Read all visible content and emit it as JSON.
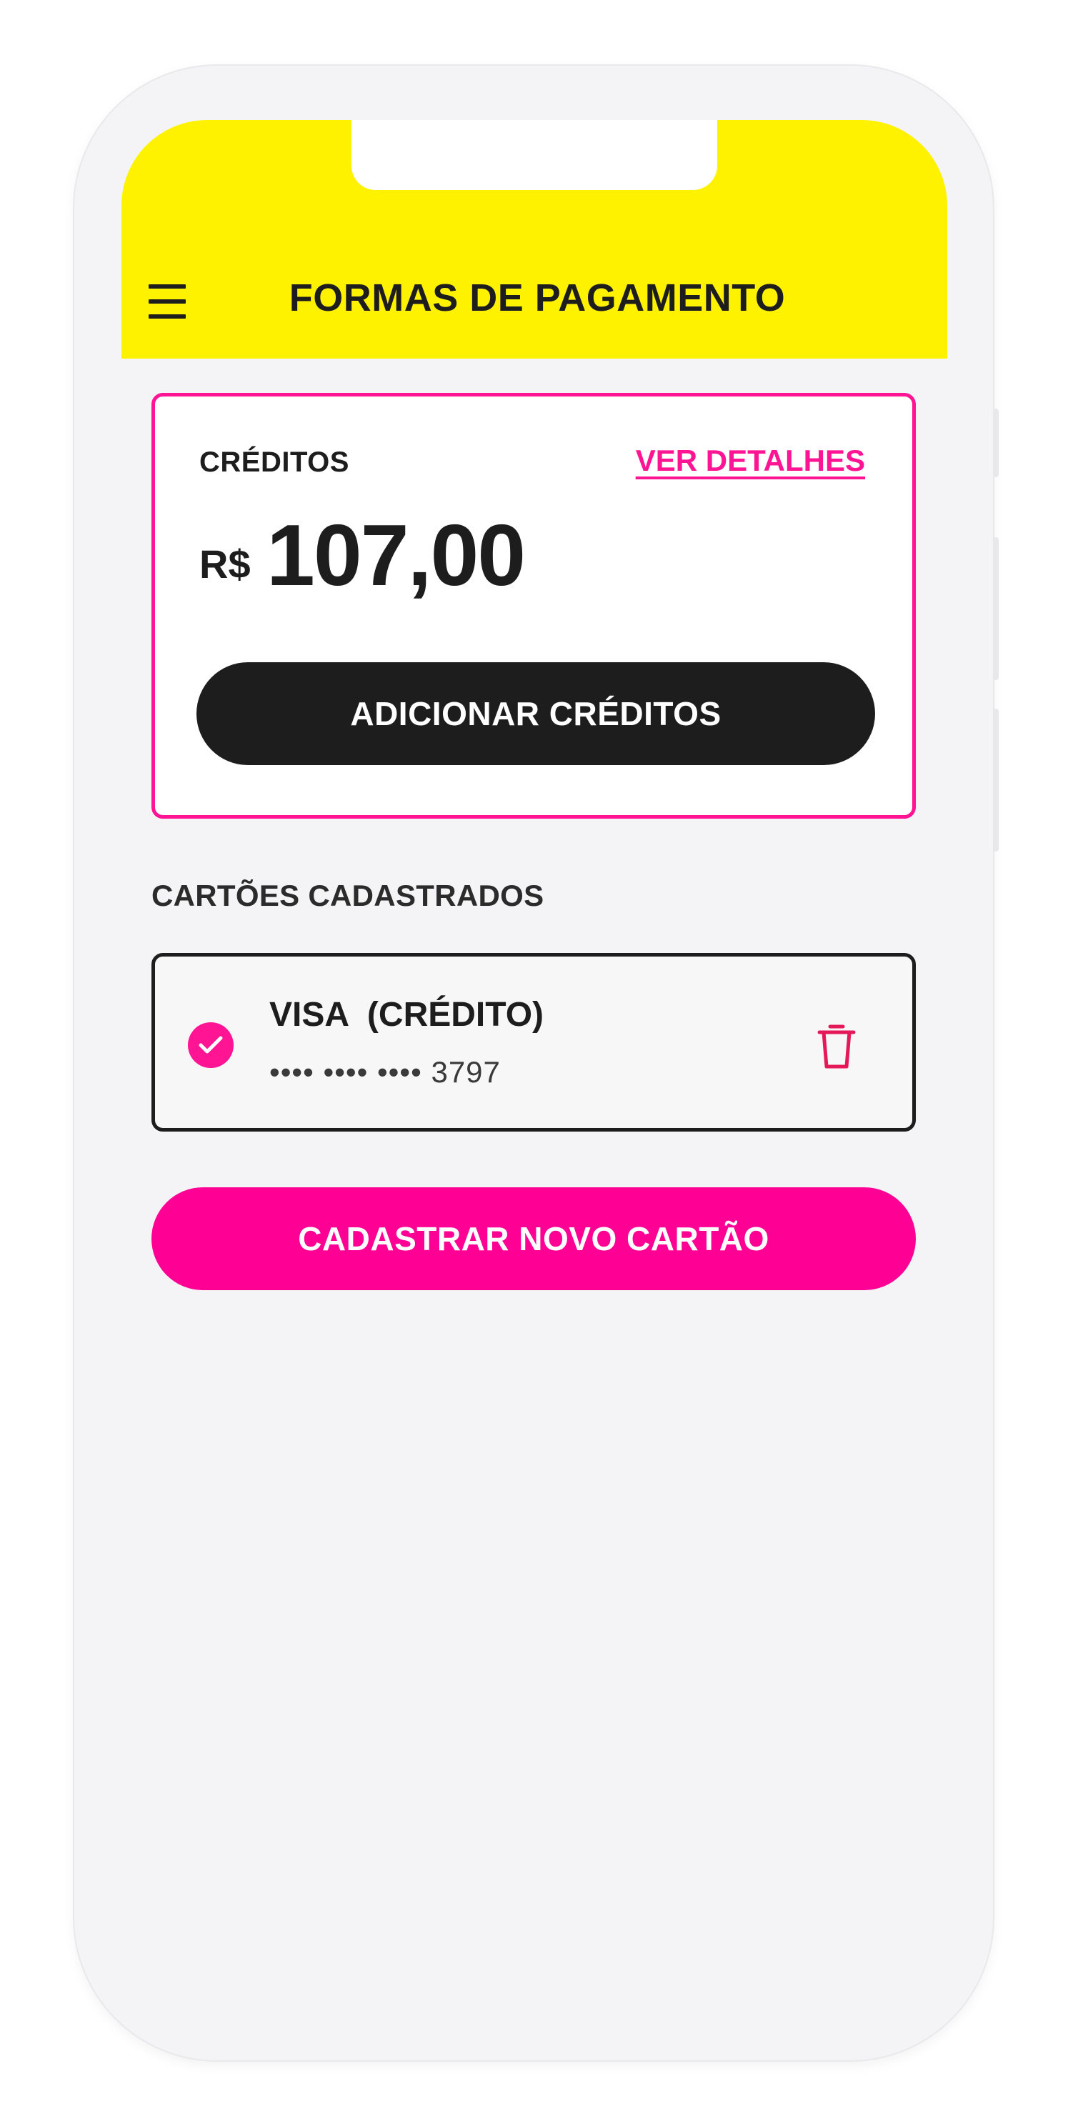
{
  "header": {
    "title": "FORMAS DE PAGAMENTO",
    "menu_icon": "hamburger-menu-icon",
    "background_color": "#fff200"
  },
  "credits": {
    "label": "CRÉDITOS",
    "details_link": "VER DETALHES",
    "currency": "R$",
    "amount": "107,00",
    "add_button": "ADICIONAR CRÉDITOS",
    "accent_color": "#ff1493"
  },
  "cards": {
    "section_title": "CARTÕES CADASTRADOS",
    "items": [
      {
        "name": "VISA  (CRÉDITO)",
        "number": "•••• •••• •••• 3797",
        "selected": true,
        "delete_icon": "trash-icon"
      }
    ],
    "new_card_button": "CADASTRAR NOVO CARTÃO",
    "button_color": "#ff0094"
  }
}
